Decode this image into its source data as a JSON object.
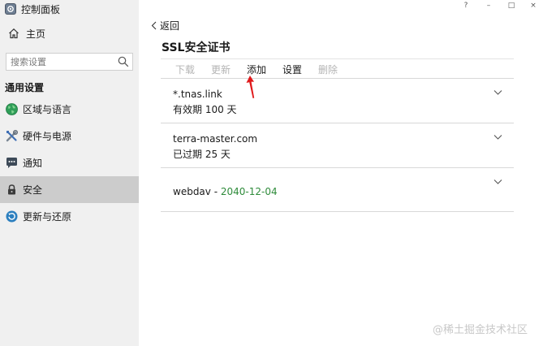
{
  "window": {
    "title": "控制面板",
    "help_label": "?",
    "minimize_label": "–",
    "maximize_label": "□",
    "close_label": "×"
  },
  "sidebar": {
    "home_label": "主页",
    "search_placeholder": "搜索设置",
    "section_heading": "通用设置",
    "items": [
      {
        "label": "区域与语言",
        "icon": "globe-icon",
        "active": false
      },
      {
        "label": "硬件与电源",
        "icon": "tools-icon",
        "active": false
      },
      {
        "label": "通知",
        "icon": "message-icon",
        "active": false
      },
      {
        "label": "安全",
        "icon": "lock-icon",
        "active": true
      },
      {
        "label": "更新与还原",
        "icon": "update-icon",
        "active": false
      }
    ]
  },
  "main": {
    "back_label": "返回",
    "page_title": "SSL安全证书",
    "toolbar": {
      "download_label": "下载",
      "update_label": "更新",
      "add_label": "添加",
      "settings_label": "设置",
      "delete_label": "删除"
    },
    "certificates": [
      {
        "name": "*.tnas.link",
        "status": "有效期 100 天"
      },
      {
        "name": "terra-master.com",
        "status": "已过期 25 天"
      },
      {
        "name": "webdav",
        "separator": " - ",
        "date": "2040-12-04"
      }
    ]
  },
  "colors": {
    "sidebar_bg": "#f0f0f0",
    "active_item_bg": "#cccccc",
    "disabled_text": "#b4b4b4",
    "date_green": "#2e8b3a",
    "annotation_arrow": "#e0191b"
  },
  "watermark": "@稀土掘金技术社区"
}
